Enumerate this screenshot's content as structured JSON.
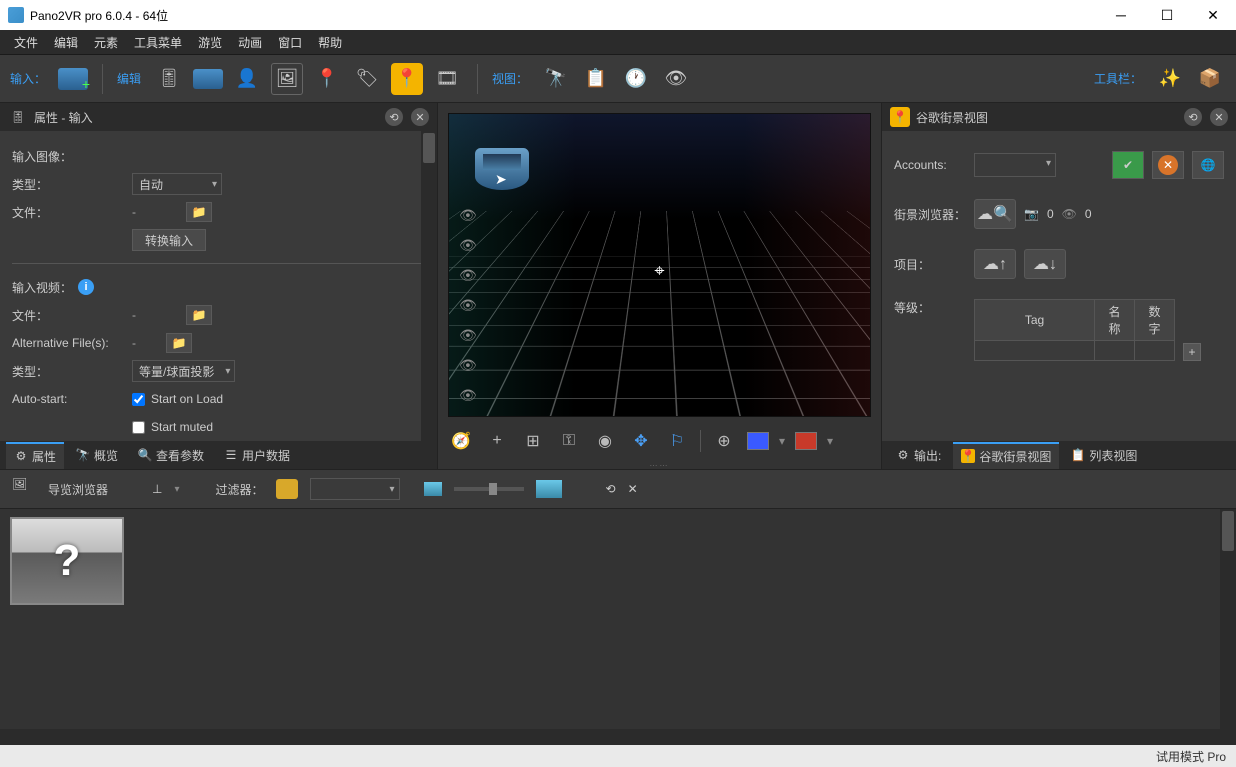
{
  "titlebar": {
    "caption": "Pano2VR pro 6.0.4 - 64位"
  },
  "menu": [
    "文件",
    "编辑",
    "元素",
    "工具菜单",
    "游览",
    "动画",
    "窗口",
    "帮助"
  ],
  "toolbar": {
    "input_label": "输入：",
    "edit_label": "编辑",
    "view_label": "视图：",
    "tools_label": "工具栏："
  },
  "left": {
    "title": "属性 - 输入",
    "input_image": "输入图像：",
    "type_label": "类型：",
    "type_value": "自动",
    "file_label": "文件：",
    "file_value": "-",
    "convert_btn": "转换输入",
    "input_video": "输入视频：",
    "alt_file_label": "Alternative File(s):",
    "alt_file_value": "-",
    "type2_value": "等量/球面投影",
    "autostart_label": "Auto-start:",
    "start_on_load": "Start on Load",
    "start_muted": "Start muted",
    "tabs": [
      "属性",
      "概览",
      "查看参数",
      "用户数据"
    ]
  },
  "right": {
    "title": "谷歌街景视图",
    "accounts": "Accounts:",
    "browser": "街景浏览器：",
    "camera_count": "0",
    "eye_count": "0",
    "project": "项目：",
    "level": "等级：",
    "table_headers": [
      "Tag",
      "名称",
      "数字"
    ],
    "tabs": {
      "output": "输出:",
      "google": "谷歌街景视图",
      "list": "列表视图"
    }
  },
  "browser": {
    "title": "导览浏览器",
    "filter": "过滤器："
  },
  "status": "试用模式 Pro"
}
